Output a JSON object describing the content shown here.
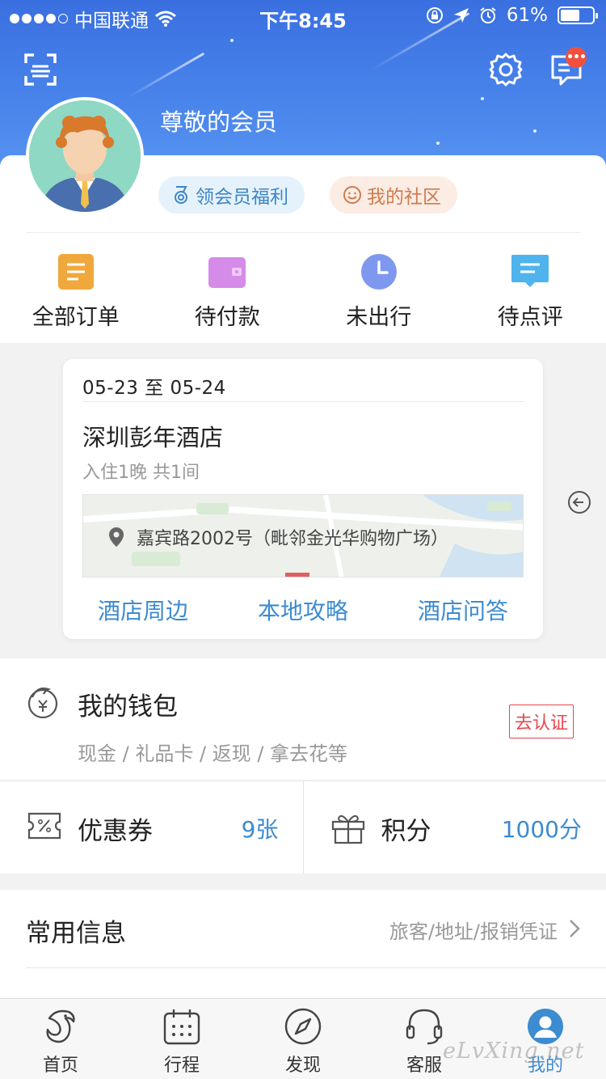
{
  "status_bar": {
    "carrier": "中国联通",
    "time": "下午8:45",
    "battery": "61%",
    "battery_level": 0.61
  },
  "header": {
    "member_name": "尊敬的会员",
    "message_badge": "•••",
    "benefit_label": "领会员福利",
    "community_label": "我的社区"
  },
  "orders": {
    "tabs": [
      {
        "label": "全部订单",
        "icon": "order-list-icon",
        "color": "#f0a83c"
      },
      {
        "label": "待付款",
        "icon": "wallet-icon",
        "color": "#d58be8"
      },
      {
        "label": "未出行",
        "icon": "clock-icon",
        "color": "#7f98ef"
      },
      {
        "label": "待点评",
        "icon": "comment-icon",
        "color": "#4fb4ee"
      }
    ]
  },
  "trip": {
    "date_range": "05-23 至 05-24",
    "hotel_name": "深圳彭年酒店",
    "stay_info": "入住1晚  共1间",
    "address": "嘉宾路2002号（毗邻金光华购物广场）",
    "links": [
      "酒店周边",
      "本地攻略",
      "酒店问答"
    ]
  },
  "wallet": {
    "title": "我的钱包",
    "subtitle": "现金 / 礼品卡 / 返现 / 拿去花等",
    "verify_label": "去认证"
  },
  "perks": {
    "coupon_label": "优惠券",
    "coupon_value": "9张",
    "points_label": "积分",
    "points_value": "1000分"
  },
  "common_info": {
    "label": "常用信息",
    "hint": "旅客/地址/报销凭证"
  },
  "tabbar": {
    "items": [
      {
        "label": "首页",
        "icon": "dolphin-home-icon"
      },
      {
        "label": "行程",
        "icon": "calendar-icon"
      },
      {
        "label": "发现",
        "icon": "compass-icon"
      },
      {
        "label": "客服",
        "icon": "headset-icon"
      },
      {
        "label": "我的",
        "icon": "profile-icon",
        "active": true
      }
    ]
  },
  "watermark": "eLvXing.net",
  "colors": {
    "accent": "#3d8bd0",
    "header_blue": "#4a86ec",
    "alert_red": "#e5484d"
  }
}
